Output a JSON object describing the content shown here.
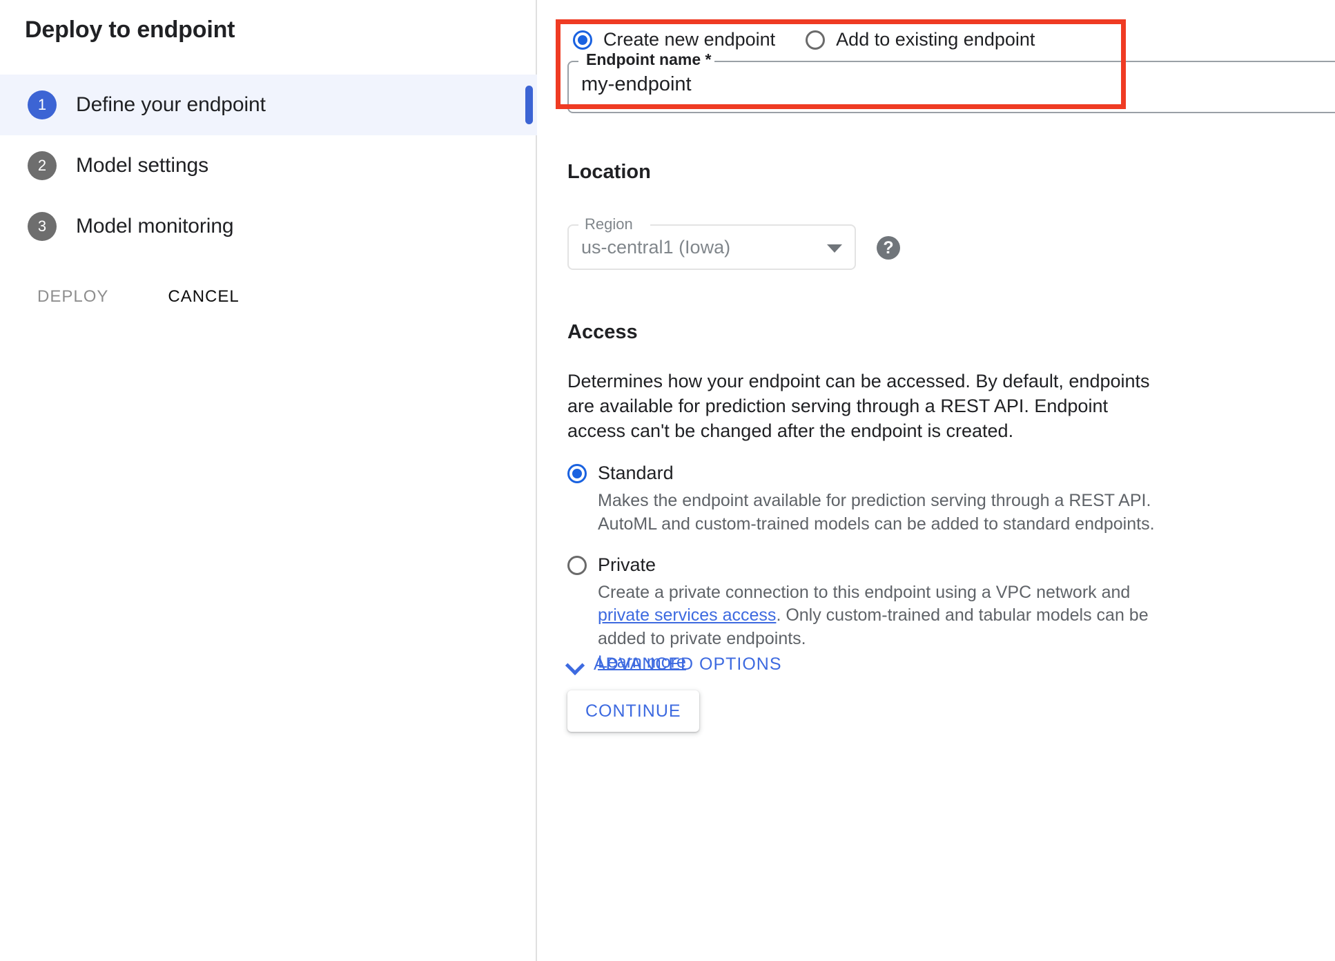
{
  "wizard": {
    "title": "Deploy to endpoint",
    "steps": [
      {
        "number": "1",
        "label": "Define your endpoint"
      },
      {
        "number": "2",
        "label": "Model settings"
      },
      {
        "number": "3",
        "label": "Model monitoring"
      }
    ],
    "actions": {
      "deploy_label": "DEPLOY",
      "cancel_label": "CANCEL"
    }
  },
  "endpoint_mode": {
    "options": [
      {
        "label": "Create new endpoint",
        "selected": true
      },
      {
        "label": "Add to existing endpoint",
        "selected": false
      }
    ]
  },
  "endpoint_name": {
    "label": "Endpoint name *",
    "value": "my-endpoint",
    "placeholder": "Endpoint name",
    "help_icon": "help-icon"
  },
  "location": {
    "heading": "Location",
    "region_label": "Region",
    "region_value": "us-central1 (Iowa)",
    "caret_icon": "chevron-down-icon",
    "help_icon": "help-icon"
  },
  "access": {
    "heading": "Access",
    "description": "Determines how your endpoint can be accessed. By default, endpoints are available for prediction serving through a REST API. Endpoint access can't be changed after the endpoint is created.",
    "options": [
      {
        "label": "Standard",
        "selected": true,
        "description": "Makes the endpoint available for prediction serving through a REST API. AutoML and custom-trained models can be added to standard endpoints."
      },
      {
        "label": "Private",
        "selected": false,
        "description_part1": "Create a private connection to this endpoint using a VPC network and ",
        "link_text": "private services access",
        "description_part2": ". Only custom-trained and tabular models can be added to private endpoints.",
        "learn_more_label": "Learn more"
      }
    ]
  },
  "footer": {
    "advanced_options_label": "ADVANCED OPTIONS",
    "advanced_caret_icon": "chevron-down-icon",
    "continue_label": "CONTINUE"
  },
  "colors": {
    "accent_blue": "#3c64d4",
    "link_blue": "#3d6ae0",
    "annotation_red": "#ef3b23",
    "step_grey": "#6e6e6e",
    "active_row_bg": "#f1f4fd",
    "muted_text": "#5f6368",
    "disabled_text": "#80868b"
  }
}
